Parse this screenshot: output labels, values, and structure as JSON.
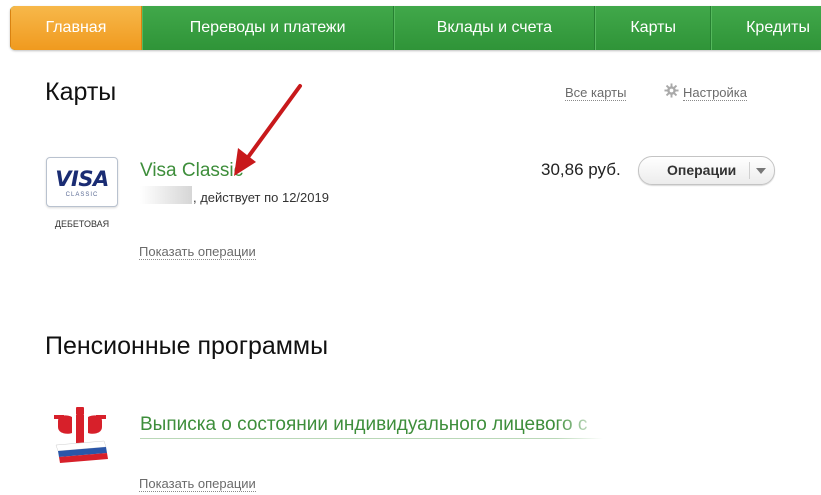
{
  "nav": {
    "tabs": [
      "Главная",
      "Переводы и платежи",
      "Вклады и счета",
      "Карты",
      "Кредиты"
    ],
    "active": 0,
    "active_color": "#f3a22d",
    "bar_color": "#35a03f"
  },
  "cards_section": {
    "title": "Карты",
    "all_cards_link": "Все карты",
    "settings_link": "Настройка"
  },
  "card": {
    "logo_word": "VISA",
    "logo_sub": "CLASSIC",
    "type_label": "ДЕБЕТОВАЯ",
    "name": "Visa Classic",
    "valid_text": ", действует по 12/2019",
    "balance": "30,86 руб.",
    "operations_button": "Операции",
    "show_operations": "Показать операции"
  },
  "pension_section": {
    "title": "Пенсионные программы",
    "statement_link": "Выписка о состоянии индивидуального лицевого с",
    "show_operations": "Показать операции"
  },
  "colors": {
    "link_green": "#3e8e3b",
    "annotation_arrow": "#c8191b"
  }
}
